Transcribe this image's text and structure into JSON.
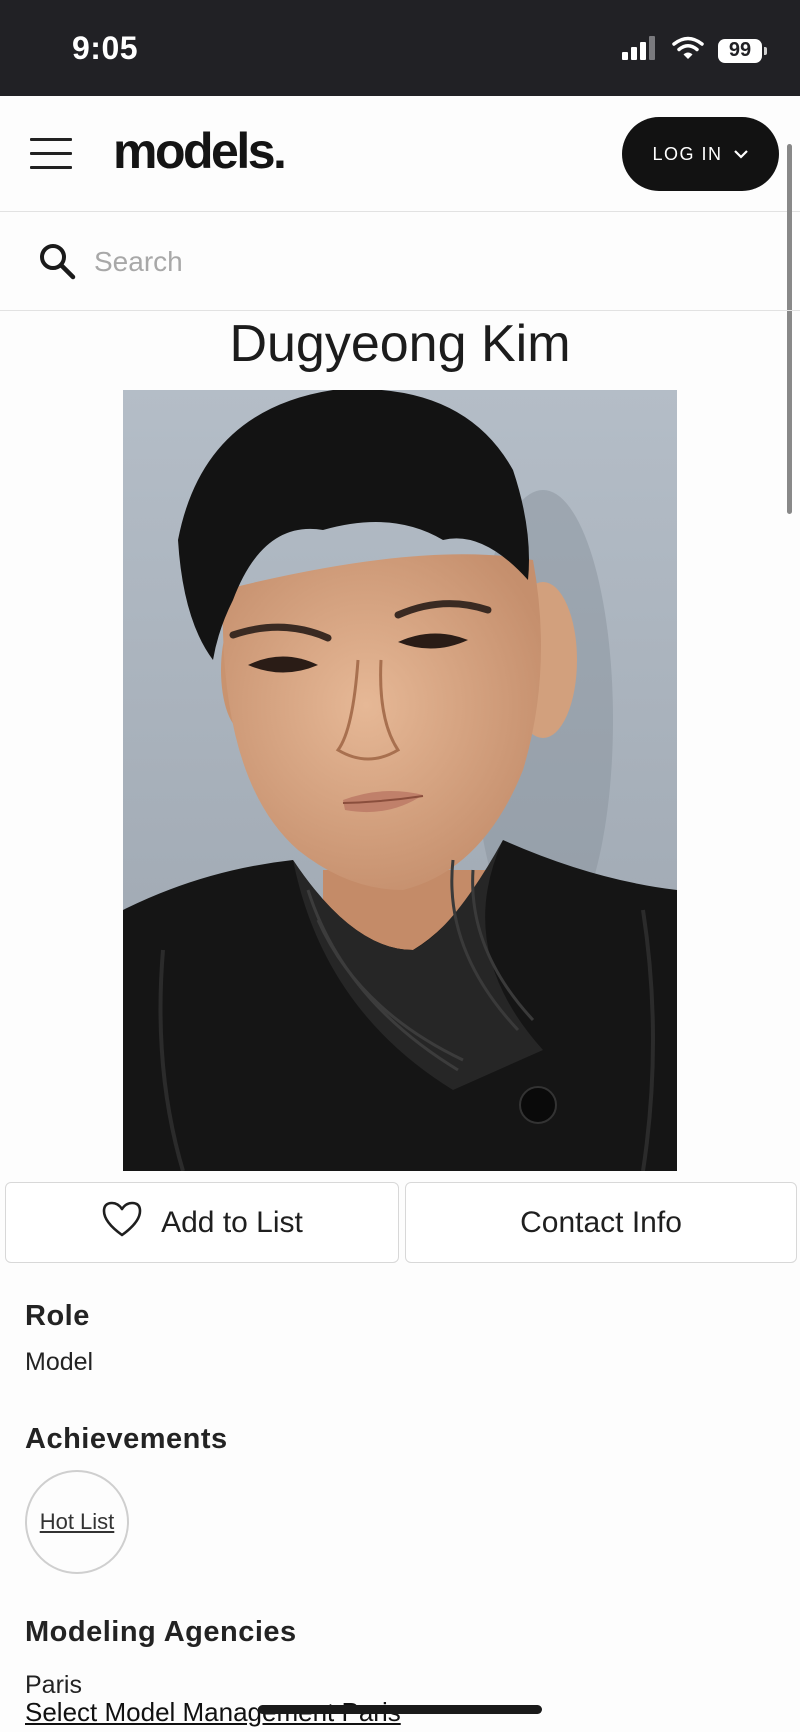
{
  "status_bar": {
    "time": "9:05",
    "battery": "99"
  },
  "header": {
    "logo": "models.",
    "login_label": "LOG IN"
  },
  "search": {
    "placeholder": "Search"
  },
  "model": {
    "name": "Dugyeong Kim"
  },
  "actions": {
    "add_to_list": "Add to List",
    "contact_info": "Contact Info"
  },
  "role": {
    "label": "Role",
    "value": "Model"
  },
  "achievements": {
    "label": "Achievements",
    "badges": [
      "Hot List"
    ]
  },
  "agencies": {
    "label": "Modeling Agencies",
    "city": "Paris",
    "agency": "Select Model Management Paris"
  },
  "icons": [
    "signal-icon",
    "wifi-icon",
    "battery-icon",
    "hamburger-menu-icon",
    "chevron-down-icon",
    "search-icon",
    "heart-icon"
  ],
  "colors": {
    "status_bar_bg": "#212125",
    "login_button_bg": "#121212",
    "page_bg": "#fdfdfd"
  }
}
